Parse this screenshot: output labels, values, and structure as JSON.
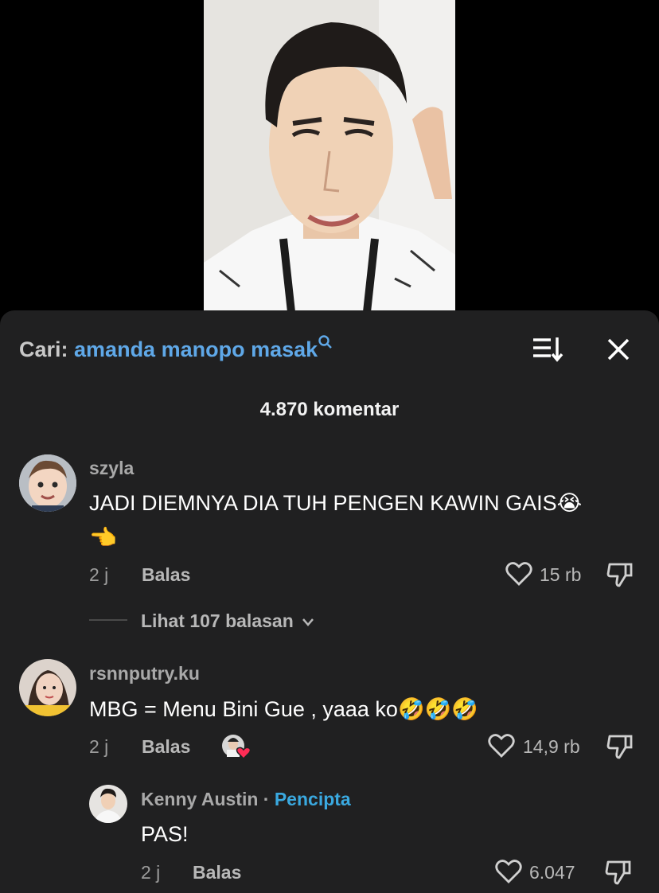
{
  "search": {
    "label": "Cari:",
    "query": "amanda manopo masak"
  },
  "comment_count": "4.870 komentar",
  "comments": [
    {
      "username": "szyla",
      "text_line1": "JADI DIEMNYA DIA TUH PENGEN KAWIN GAIS",
      "emoji1": "😭",
      "emoji2": "👈",
      "time": "2 j",
      "reply_label": "Balas",
      "likes": "15 rb",
      "view_replies": "Lihat 107 balasan"
    },
    {
      "username": "rsnnputry.ku",
      "text": "MBG = Menu Bini Gue , yaaa ko",
      "emojis": "🤣🤣🤣",
      "time": "2 j",
      "reply_label": "Balas",
      "likes": "14,9 rb"
    }
  ],
  "creator_reply": {
    "username": "Kenny Austin",
    "separator": "·",
    "badge": "Pencipta",
    "text": "PAS!",
    "time": "2 j",
    "reply_label": "Balas",
    "likes": "6.047"
  }
}
